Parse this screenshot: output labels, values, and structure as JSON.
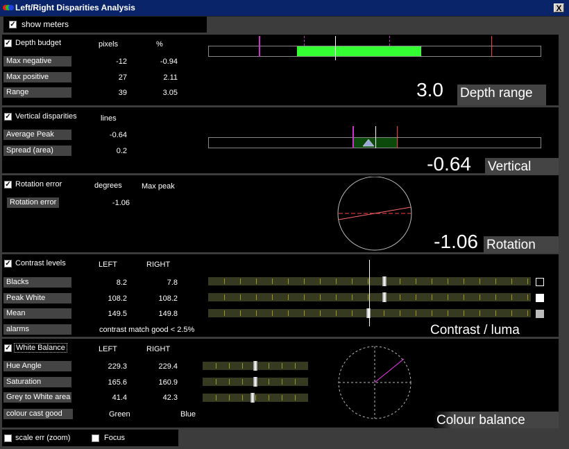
{
  "window": {
    "title": "Left/Right Disparities Analysis",
    "close_label": "X"
  },
  "show_meters": {
    "label": "show meters",
    "checked": true
  },
  "depth": {
    "checkbox_label": "Depth budget",
    "col1": "pixels",
    "col2": "%",
    "rows": [
      {
        "label": "Max negative",
        "v1": "-12",
        "v2": "-0.94"
      },
      {
        "label": "Max positive",
        "v1": "27",
        "v2": "2.11"
      },
      {
        "label": "Range",
        "v1": "39",
        "v2": "3.05"
      }
    ],
    "big_value": "3.0",
    "caption": "Depth range"
  },
  "vertical": {
    "checkbox_label": "Vertical disparities",
    "col1": "lines",
    "rows": [
      {
        "label": "Average Peak",
        "v1": "-0.64"
      },
      {
        "label": "Spread (area)",
        "v1": "0.2"
      }
    ],
    "big_value": "-0.64",
    "caption": "Vertical"
  },
  "rotation": {
    "checkbox_label": "Rotation error",
    "col1": "degrees",
    "col2": "Max peak",
    "rows": [
      {
        "label": "Rotation error",
        "v1": "-1.06"
      }
    ],
    "big_value": "-1.06",
    "caption": "Rotation"
  },
  "contrast": {
    "checkbox_label": "Contrast levels",
    "col1": "LEFT",
    "col2": "RIGHT",
    "rows": [
      {
        "label": "Blacks",
        "v1": "8.2",
        "v2": "7.8"
      },
      {
        "label": "Peak White",
        "v1": "108.2",
        "v2": "108.2"
      },
      {
        "label": "Mean",
        "v1": "149.5",
        "v2": "149.8"
      }
    ],
    "alarms_label": "alarms",
    "alarms_text": "contrast match good < 2.5%",
    "caption": "Contrast / luma"
  },
  "white_balance": {
    "checkbox_label": "White Balance",
    "col1": "LEFT",
    "col2": "RIGHT",
    "rows": [
      {
        "label": "Hue Angle",
        "v1": "229.3",
        "v2": "229.4"
      },
      {
        "label": "Saturation",
        "v1": "165.6",
        "v2": "160.9"
      },
      {
        "label": "Grey to White area",
        "v1": "41.4",
        "v2": "42.3"
      }
    ],
    "cast_label": "colour cast  good",
    "cast_v1": "Green",
    "cast_v2": "Blue",
    "caption": "Colour balance"
  },
  "footer": {
    "scale_label": "scale err (zoom)",
    "focus_label": "Focus"
  },
  "colors": {
    "titlebar": "#0a246a",
    "green_bar": "#33ff33",
    "dark_green": "#0b4a0b",
    "magenta": "#cc33cc",
    "red": "#ff3b3b",
    "track": "#363a20"
  }
}
